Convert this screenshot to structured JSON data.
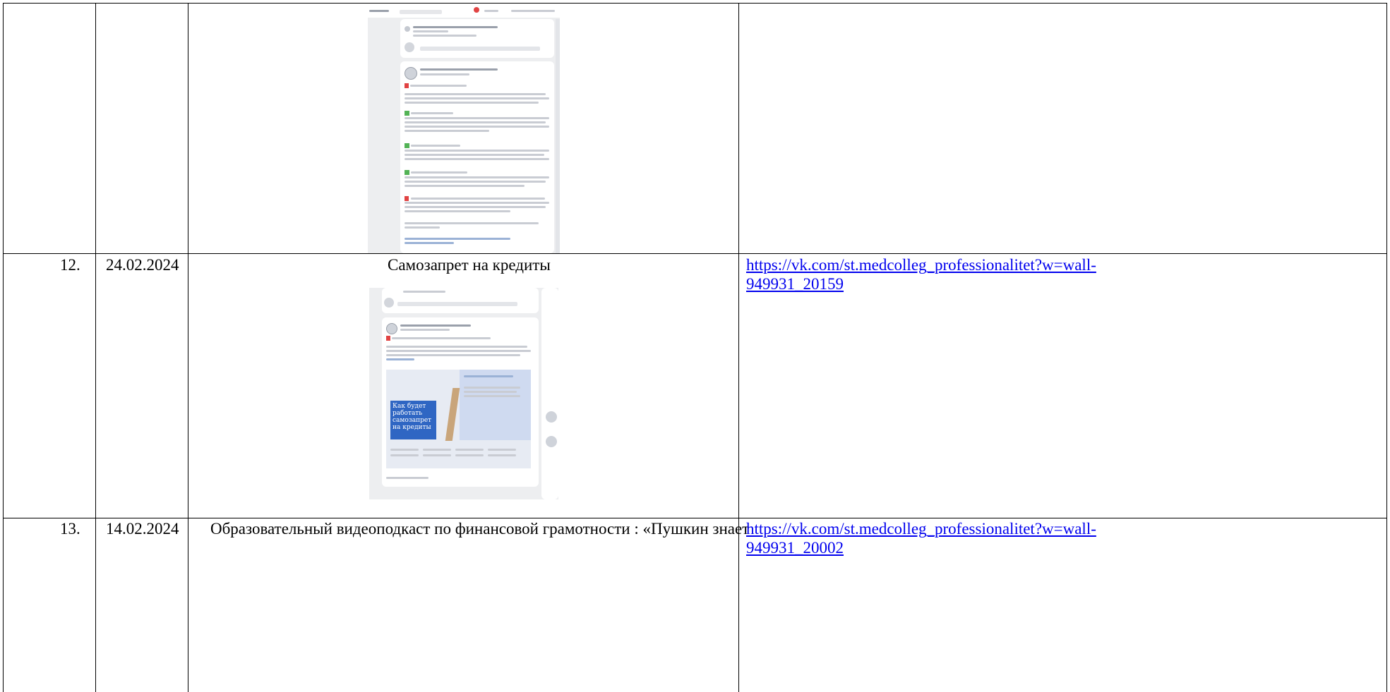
{
  "rows": [
    {
      "num": "",
      "date": "",
      "title": "",
      "link_line1": "",
      "link_line2": ""
    },
    {
      "num": "12.",
      "date": "24.02.2024",
      "title": "Самозапрет на кредиты",
      "link_line1": "https://vk.com/st.medcolleg_professionalitet?w=wall-",
      "link_line2": "949931_20159"
    },
    {
      "num": "13.",
      "date": "14.02.2024",
      "title": "Образовательный видеоподкаст по финансовой грамотности : «Пушкин знает",
      "link_line1": "https://vk.com/st.medcolleg_professionalitet?w=wall-",
      "link_line2": "949931_20002"
    }
  ],
  "screenshot2": {
    "banner_text": "Как будет работать самозапрет на кредиты"
  },
  "colors": {
    "link": "#0000ee",
    "border": "#000000",
    "vk_blue": "#2f66c3"
  },
  "icons": [
    "vk-logo-icon",
    "avatar-icon",
    "notification-icon"
  ]
}
